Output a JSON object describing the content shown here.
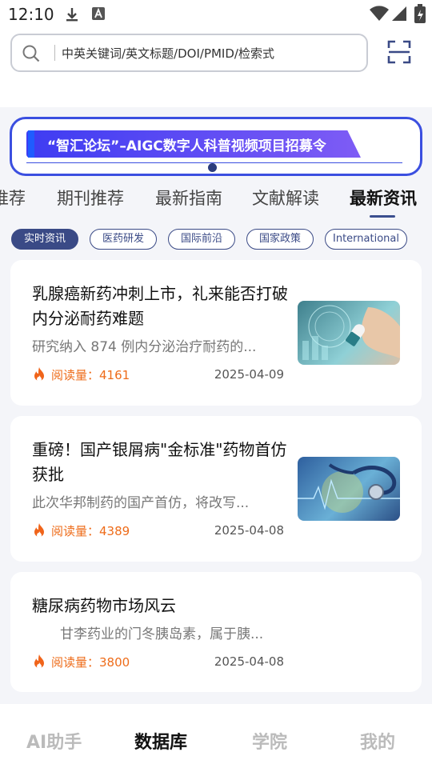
{
  "status_bar": {
    "time": "12:10",
    "icons": [
      "download-icon",
      "font-icon",
      "wifi-icon",
      "signal-icon",
      "battery-icon"
    ]
  },
  "search": {
    "placeholder": "中英关键词/英文标题/DOI/PMID/检索式",
    "icon": "search-icon",
    "scan_icon": "scan-icon"
  },
  "banner": {
    "text": "“智汇论坛”–AIGC数字人科普视频项目招募令"
  },
  "tabs": [
    {
      "label": "推荐"
    },
    {
      "label": "期刊推荐"
    },
    {
      "label": "最新指南"
    },
    {
      "label": "文献解读"
    },
    {
      "label": "最新资讯"
    }
  ],
  "active_tab": "最新资讯",
  "chips": [
    {
      "label": "实时资讯"
    },
    {
      "label": "医药研发"
    },
    {
      "label": "国际前沿"
    },
    {
      "label": "国家政策"
    },
    {
      "label": "International"
    }
  ],
  "active_chip": "实时资讯",
  "articles": [
    {
      "title": "乳腺癌新药冲刺上市，礼来能否打破内分泌耐药难题",
      "summary": "研究纳入 874 例内分泌治疗耐药的...",
      "reads": "阅读量：4161",
      "date": "2025-04-09",
      "thumb": "pill-image"
    },
    {
      "title": "重磅！国产银屑病\"金标准\"药物首仿获批",
      "summary": "此次华邦制药的国产首仿，将改写...",
      "reads": "阅读量：4389",
      "date": "2025-04-08",
      "thumb": "stethoscope-image"
    },
    {
      "title": "糖尿病药物市场风云",
      "summary": "甘李药业的门冬胰岛素，属于胰...",
      "reads": "阅读量：3800",
      "date": "2025-04-08"
    }
  ],
  "bottom_nav": [
    {
      "label": "AI助手"
    },
    {
      "label": "数据库"
    },
    {
      "label": "学院"
    },
    {
      "label": "我的"
    }
  ],
  "active_nav": "数据库",
  "colors": {
    "accent": "#3a4a86",
    "banner_blue": "#3b4fe0",
    "reads_orange": "#ee6c1a"
  }
}
